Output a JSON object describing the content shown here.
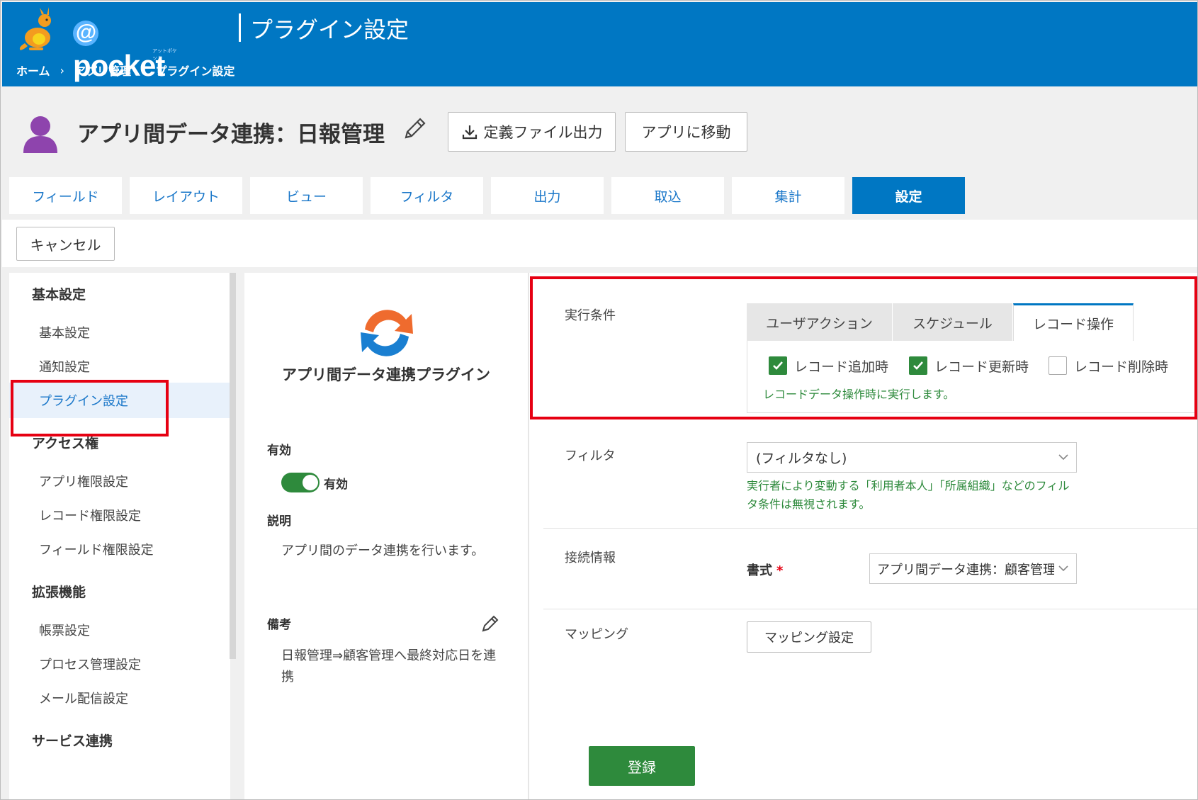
{
  "header": {
    "logo_text": "pocket",
    "logo_at": "@",
    "logo_sub": "アットポケット",
    "title": "プラグイン設定",
    "breadcrumb": [
      "ホーム",
      "アプリ管理",
      "プラグイン設定"
    ],
    "breadcrumb_sep": "›",
    "bg_color": "#0077c3"
  },
  "app": {
    "title": "アプリ間データ連携：日報管理",
    "export_button": "定義ファイル出力",
    "goto_button": "アプリに移動"
  },
  "tabs": [
    {
      "label": "フィールド",
      "active": false
    },
    {
      "label": "レイアウト",
      "active": false
    },
    {
      "label": "ビュー",
      "active": false
    },
    {
      "label": "フィルタ",
      "active": false
    },
    {
      "label": "出力",
      "active": false
    },
    {
      "label": "取込",
      "active": false
    },
    {
      "label": "集計",
      "active": false
    },
    {
      "label": "設定",
      "active": true
    }
  ],
  "toolbar": {
    "cancel_label": "キャンセル"
  },
  "sidebar": {
    "groups": [
      {
        "label": "基本設定",
        "items": [
          "基本設定",
          "通知設定",
          "プラグイン設定"
        ]
      },
      {
        "label": "アクセス権",
        "items": [
          "アプリ権限設定",
          "レコード権限設定",
          "フィールド権限設定"
        ]
      },
      {
        "label": "拡張機能",
        "items": [
          "帳票設定",
          "プロセス管理設定",
          "メール配信設定"
        ]
      },
      {
        "label": "サービス連携",
        "items": []
      }
    ],
    "active_item": "プラグイン設定"
  },
  "plugin": {
    "name": "アプリ間データ連携プラグイン",
    "enabled_label": "有効",
    "toggle_label": "有効",
    "toggle_on": true,
    "description_label": "説明",
    "description": "アプリ間のデータ連携を行います。",
    "note_label": "備考",
    "note": "日報管理⇒顧客管理へ最終対応日を連携"
  },
  "settings": {
    "exec_label": "実行条件",
    "exec_tabs": [
      {
        "label": "ユーザアクション",
        "active": false
      },
      {
        "label": "スケジュール",
        "active": false
      },
      {
        "label": "レコード操作",
        "active": true
      }
    ],
    "checkboxes": [
      {
        "label": "レコード追加時",
        "checked": true
      },
      {
        "label": "レコード更新時",
        "checked": true
      },
      {
        "label": "レコード削除時",
        "checked": false
      }
    ],
    "exec_help": "レコードデータ操作時に実行します。",
    "filter_label": "フィルタ",
    "filter_value": "(フィルタなし)",
    "filter_help": "実行者により変動する「利用者本人」「所属組織」などのフィルタ条件は無視されます。",
    "connection_label": "接続情報",
    "format_label": "書式",
    "format_required": "*",
    "format_value": "アプリ間データ連携：顧客管理",
    "mapping_label": "マッピング",
    "mapping_button": "マッピング設定",
    "register_button": "登録"
  },
  "colors": {
    "accent": "#0077c3",
    "highlight": "#e60012",
    "success": "#2e8a3c"
  }
}
